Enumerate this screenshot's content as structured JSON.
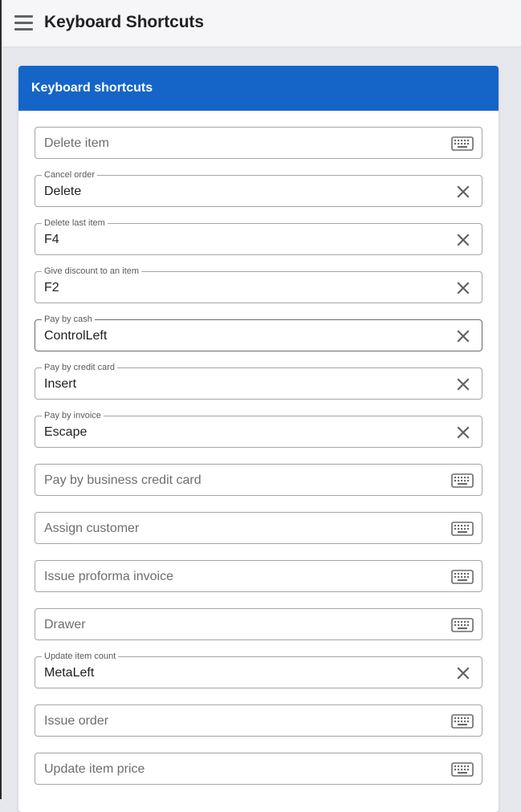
{
  "header": {
    "title": "Keyboard Shortcuts",
    "menu_icon": "hamburger-menu-icon"
  },
  "card": {
    "title": "Keyboard shortcuts"
  },
  "shortcuts": [
    {
      "label": "Delete item",
      "value": ""
    },
    {
      "label": "Cancel order",
      "value": "Delete"
    },
    {
      "label": "Delete last item",
      "value": "F4"
    },
    {
      "label": "Give discount to an item",
      "value": "F2"
    },
    {
      "label": "Pay by cash",
      "value": "ControlLeft"
    },
    {
      "label": "Pay by credit card",
      "value": "Insert"
    },
    {
      "label": "Pay by invoice",
      "value": "Escape"
    },
    {
      "label": "Pay by business credit card",
      "value": ""
    },
    {
      "label": "Assign customer",
      "value": ""
    },
    {
      "label": "Issue proforma invoice",
      "value": ""
    },
    {
      "label": "Drawer",
      "value": ""
    },
    {
      "label": "Update item count",
      "value": "MetaLeft"
    },
    {
      "label": "Issue order",
      "value": ""
    },
    {
      "label": "Update item price",
      "value": ""
    }
  ],
  "icons": {
    "empty_field": "keyboard-icon",
    "filled_field": "clear-icon"
  },
  "colors": {
    "header_blue": "#1565c8",
    "page_background": "#e6e8ee",
    "topbar_background": "#f6f5f8"
  }
}
